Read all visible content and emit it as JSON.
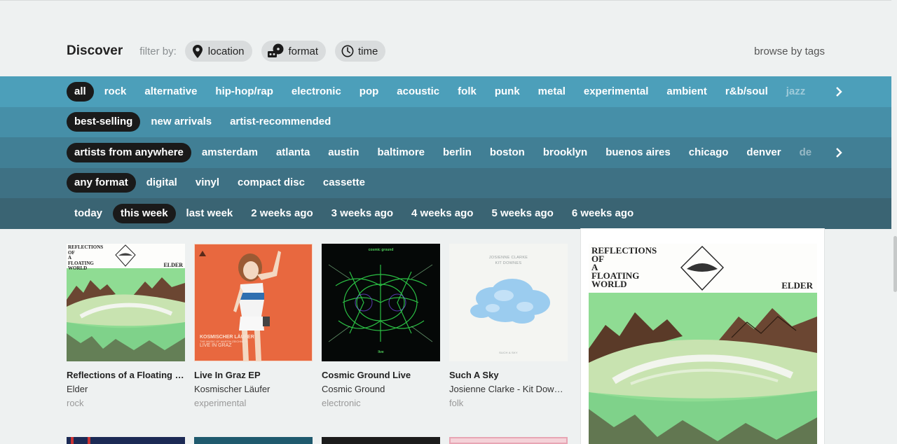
{
  "header": {
    "title": "Discover",
    "filter_label": "filter by:",
    "filters": [
      {
        "label": "location",
        "icon": "location-pin-icon"
      },
      {
        "label": "format",
        "icon": "format-icon"
      },
      {
        "label": "time",
        "icon": "clock-icon"
      }
    ],
    "browse_label": "browse by tags"
  },
  "genres": [
    "all",
    "rock",
    "alternative",
    "hip-hop/rap",
    "electronic",
    "pop",
    "acoustic",
    "folk",
    "punk",
    "metal",
    "experimental",
    "ambient",
    "r&b/soul",
    "jazz"
  ],
  "sorts": [
    "best-selling",
    "new arrivals",
    "artist-recommended"
  ],
  "locations": [
    "artists from anywhere",
    "amsterdam",
    "atlanta",
    "austin",
    "baltimore",
    "berlin",
    "boston",
    "brooklyn",
    "buenos aires",
    "chicago",
    "denver",
    "de"
  ],
  "formats": [
    "any format",
    "digital",
    "vinyl",
    "compact disc",
    "cassette"
  ],
  "times": [
    "today",
    "this week",
    "last week",
    "2 weeks ago",
    "3 weeks ago",
    "4 weeks ago",
    "5 weeks ago",
    "6 weeks ago"
  ],
  "albums": [
    {
      "title": "Reflections of a Floating World",
      "artist": "Elder",
      "genre": "rock"
    },
    {
      "title": "Live In Graz EP",
      "artist": "Kosmischer Läufer",
      "genre": "experimental"
    },
    {
      "title": "Cosmic Ground Live",
      "artist": "Cosmic Ground",
      "genre": "electronic"
    },
    {
      "title": "Such A Sky",
      "artist": "Josienne Clarke - Kit Downes",
      "genre": "folk"
    }
  ],
  "art_text": {
    "elder_lines": [
      "REFLECTIONS",
      "OF",
      "A",
      "FLOATING",
      "WORLD"
    ],
    "elder_band": "ELDER",
    "graz_lines": [
      "KOSMISCHER LÄUFER",
      "THE MUSIC OF MARTIN ZEICHNETE",
      "LIVE IN GRAZ"
    ],
    "cosmic_top": "cosmic ground",
    "cosmic_bottom": "live",
    "sky_lines": [
      "JOSIENNE CLARKE",
      "KIT DOWNES"
    ],
    "sky_bottom": "SUCH A SKY"
  },
  "colors": {
    "genre_band": "#4c9fba",
    "selected_pill": "#1a1a1a",
    "graz_bg": "#e8683f"
  }
}
